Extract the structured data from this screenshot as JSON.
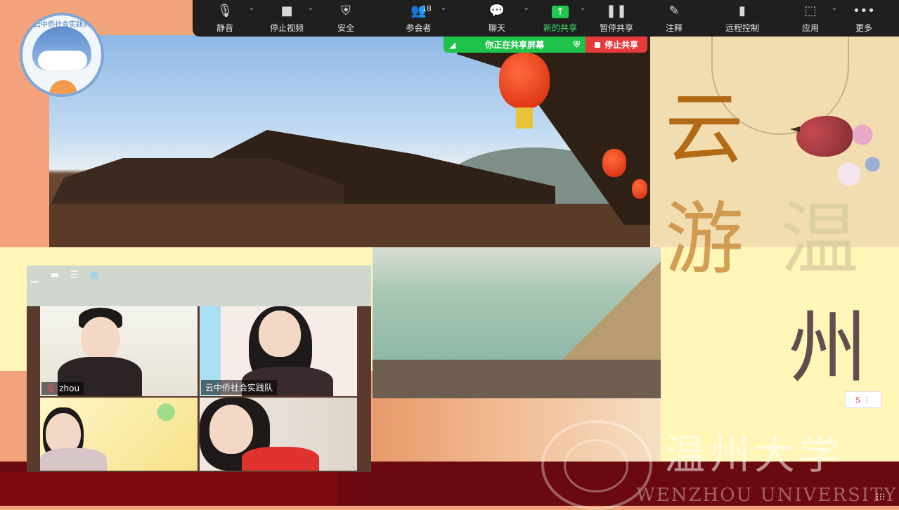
{
  "toolbar": {
    "items": [
      {
        "label": "静音",
        "icon": "microphone-icon"
      },
      {
        "label": "停止视频",
        "icon": "video-camera-icon"
      },
      {
        "label": "安全",
        "icon": "shield-icon"
      },
      {
        "label": "参会者",
        "icon": "participants-icon",
        "count": "18"
      },
      {
        "label": "聊天",
        "icon": "chat-bubble-icon"
      },
      {
        "label": "新的共享",
        "icon": "share-screen-icon"
      },
      {
        "label": "暂停共享",
        "icon": "pause-icon"
      },
      {
        "label": "注释",
        "icon": "pencil-icon"
      },
      {
        "label": "远程控制",
        "icon": "mouse-icon"
      },
      {
        "label": "应用",
        "icon": "apps-icon"
      },
      {
        "label": "更多",
        "icon": "more-dots-icon"
      }
    ],
    "accent_green": "#3ee26a"
  },
  "sharing": {
    "status": "你正在共享屏幕",
    "stop_label": "停止共享",
    "green": "#1fc24a",
    "red": "#e5393a"
  },
  "slide": {
    "title_chars": [
      "云",
      "游",
      "温",
      "州"
    ],
    "university_cn": "温州大学",
    "university_en": "WENZHOU UNIVERSITY",
    "team_logo_text": "云中侨社会实践队"
  },
  "gallery": {
    "participants": [
      {
        "name": "zhou",
        "muted": true
      },
      {
        "name": "云中侨社会实践队",
        "muted": false
      },
      {
        "name": "",
        "muted": false
      },
      {
        "name": "",
        "muted": false
      }
    ]
  }
}
